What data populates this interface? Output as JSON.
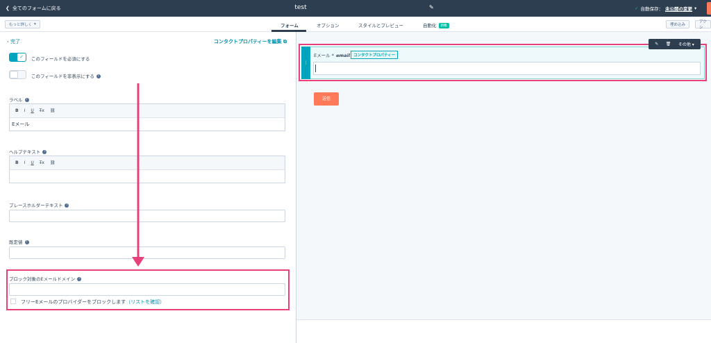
{
  "topbar": {
    "back_label": "全てのフォームに戻る",
    "title": "test",
    "autosave_label": "自動保存：",
    "autosave_link": "未公開の変更"
  },
  "tabbar": {
    "more_label": "もっと詳しく",
    "tabs": [
      {
        "label": "フォーム"
      },
      {
        "label": "オプション"
      },
      {
        "label": "スタイルとプレビュー"
      },
      {
        "label": "自動化"
      }
    ],
    "new_badge": "新機",
    "embed_label": "埋め込み",
    "action_label": "アクシ"
  },
  "editor_panel": {
    "done_label": "完了",
    "edit_property_label": "コンタクトプロパティーを編集",
    "required_toggle_label": "このフィールドを必須にする",
    "hidden_toggle_label": "このフィールドを非表示にする",
    "label_field_label": "ラベル",
    "label_value": "Eメール",
    "help_text_label": "ヘルプテキスト",
    "placeholder_label": "プレースホルダーテキスト",
    "default_value_label": "既定値",
    "blocked_domains_label": "ブロック対象のEメールドメイン",
    "block_free_label": "フリーEメールのプロバイダーをブロックします",
    "see_list_label": "（リストを確認）",
    "toolbar_bold": "B",
    "toolbar_italic": "I",
    "toolbar_underline": "U",
    "toolbar_clear": "T̶x",
    "toolbar_link": "⛓"
  },
  "preview": {
    "field_label": "Eメール *",
    "field_internal_name": "email",
    "contact_property_tag": "コンタクトプロパティー",
    "submit_label": "送信",
    "float_more_label": "その他"
  },
  "colors": {
    "topbar_bg": "#2d3e50",
    "accent_teal": "#00a4bd",
    "highlight_pink": "#e8407a",
    "submit_orange": "#ff7a59"
  }
}
